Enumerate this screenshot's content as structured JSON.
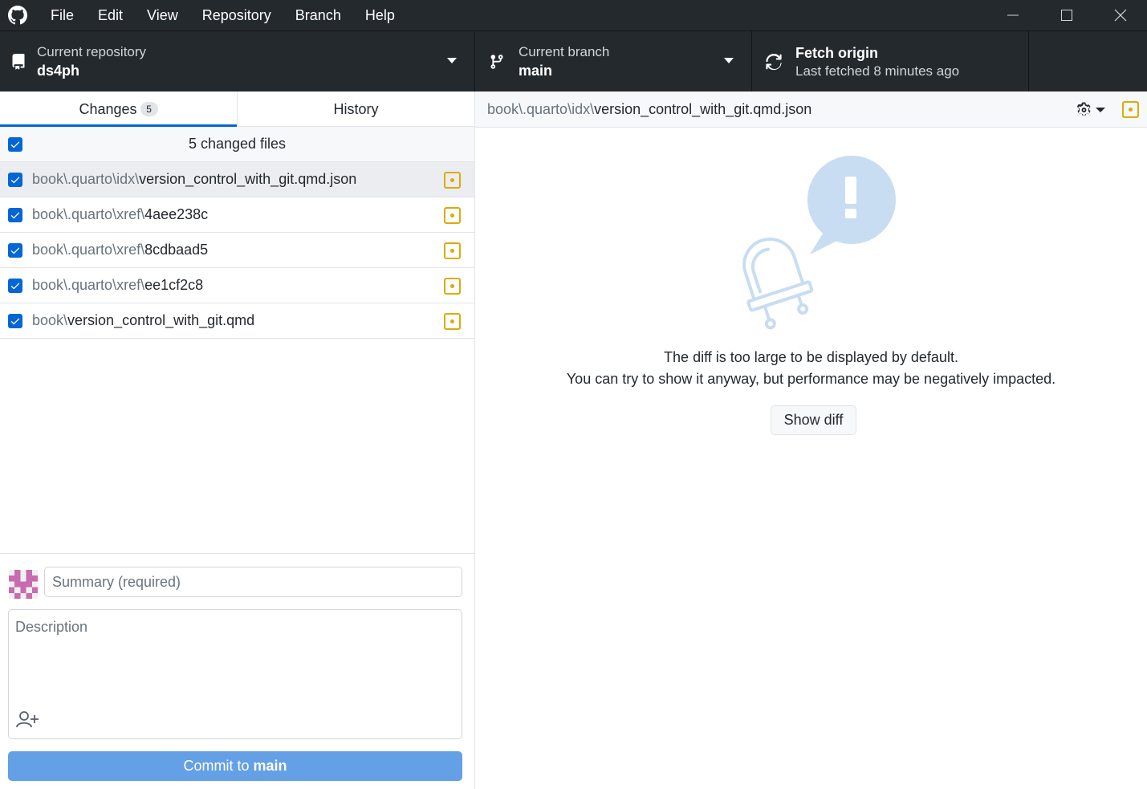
{
  "menu": {
    "items": [
      "File",
      "Edit",
      "View",
      "Repository",
      "Branch",
      "Help"
    ]
  },
  "toolbar": {
    "repository": {
      "label": "Current repository",
      "value": "ds4ph"
    },
    "branch": {
      "label": "Current branch",
      "value": "main"
    },
    "fetch": {
      "label": "Fetch origin",
      "status": "Last fetched 8 minutes ago"
    }
  },
  "tabs": {
    "changes": {
      "label": "Changes",
      "count": "5"
    },
    "history": {
      "label": "History"
    }
  },
  "files": {
    "header": "5 changed files",
    "items": [
      {
        "dir": "book\\.quarto\\idx\\",
        "name": "version_control_with_git.qmd.json",
        "checked": true,
        "selected": true,
        "status": "modified"
      },
      {
        "dir": "book\\.quarto\\xref\\",
        "name": "4aee238c",
        "checked": true,
        "selected": false,
        "status": "modified"
      },
      {
        "dir": "book\\.quarto\\xref\\",
        "name": "8cdbaad5",
        "checked": true,
        "selected": false,
        "status": "modified"
      },
      {
        "dir": "book\\.quarto\\xref\\",
        "name": "ee1cf2c8",
        "checked": true,
        "selected": false,
        "status": "modified"
      },
      {
        "dir": "book\\",
        "name": "version_control_with_git.qmd",
        "checked": true,
        "selected": false,
        "status": "modified"
      }
    ]
  },
  "commit": {
    "summary_placeholder": "Summary (required)",
    "summary_value": "",
    "description_placeholder": "Description",
    "description_value": "",
    "button_prefix": "Commit to ",
    "button_branch": "main"
  },
  "diff": {
    "path_dir": "book\\.quarto\\idx\\",
    "path_name": "version_control_with_git.qmd.json",
    "message_line1": "The diff is too large to be displayed by default.",
    "message_line2": "You can try to show it anyway, but performance may be negatively impacted.",
    "show_button": "Show diff"
  },
  "colors": {
    "titlebar": "#24292e",
    "accent": "#0366d6",
    "modified": "#dbab09",
    "commit_button": "#64a0e6"
  },
  "icons": {
    "app": "github-logo-icon",
    "repo": "repo-icon",
    "branch": "git-branch-icon",
    "fetch": "sync-icon",
    "settings": "gear-icon",
    "coauthor": "person-add-icon"
  }
}
